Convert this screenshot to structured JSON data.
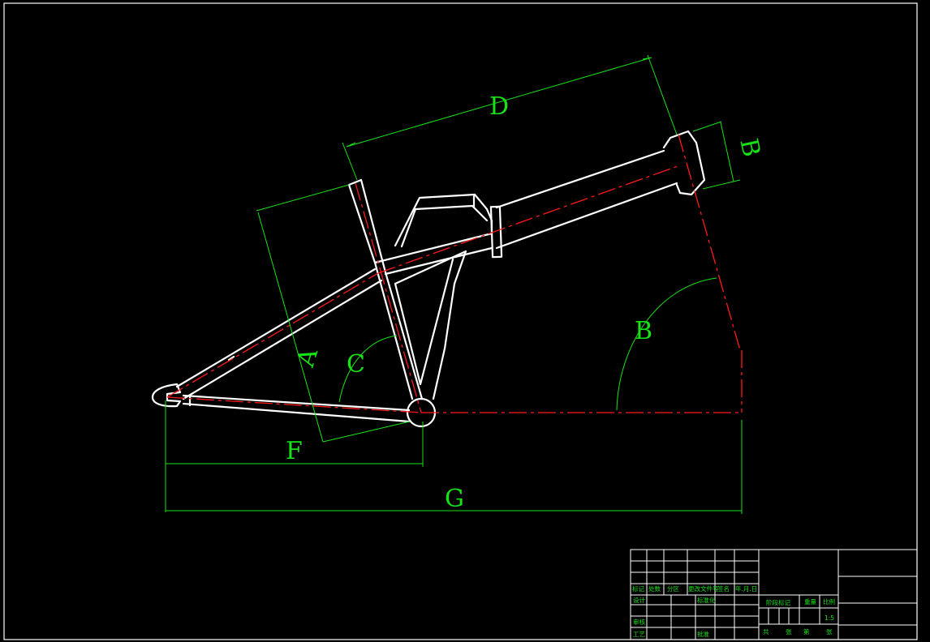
{
  "drawing": {
    "colors": {
      "background": "#000000",
      "frame": "#ffffff",
      "centerline": "#ff1a1a",
      "dimension": "#16e216"
    },
    "dimension_labels": {
      "a": "A",
      "b_tube": "B",
      "b_angle": "B",
      "c": "C",
      "d": "D",
      "f": "F",
      "g": "G"
    }
  },
  "title_block": {
    "revision_row": [
      "标记",
      "处数",
      "分区",
      "更改文件号",
      "签名",
      "年.月.日"
    ],
    "left_rows": [
      [
        "设计",
        "",
        "标准化"
      ],
      [
        "审核",
        "",
        ""
      ],
      [
        "工艺",
        "",
        "批准"
      ]
    ],
    "stage_header": "阶段标记",
    "weight_header": "重量",
    "scale_header": "比例",
    "scale_value": "1:5",
    "sheet_footer": [
      "共",
      "张",
      "第",
      "张"
    ]
  }
}
